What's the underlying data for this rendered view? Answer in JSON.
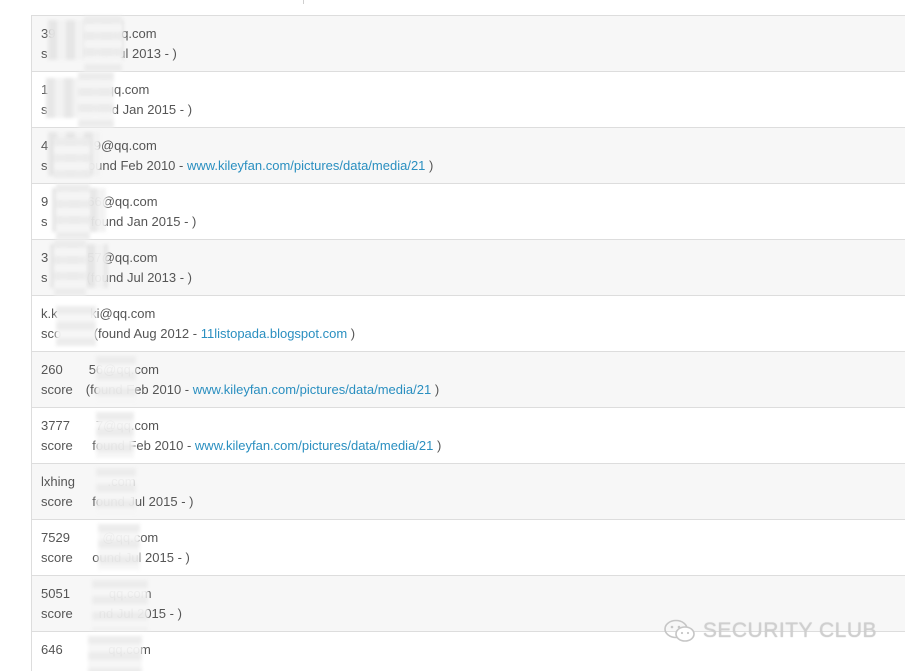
{
  "rows": [
    {
      "email": "39         qq.com",
      "details_prefix": "s      und Jul 2013 - )",
      "link": "",
      "suffix": ""
    },
    {
      "email": "1         qq.com",
      "details_prefix": "s      found Jan 2015 - )",
      "link": "",
      "suffix": ""
    },
    {
      "email": "4       9@qq.com",
      "details_prefix": "s     (found Feb 2010 - ",
      "link": "www.kileyfan.com/pictures/data/media/21",
      "suffix": " )"
    },
    {
      "email": "9      66@qq.com",
      "details_prefix": "s      (found Jan 2015 - )",
      "link": "",
      "suffix": ""
    },
    {
      "email": "3      57@qq.com",
      "details_prefix": "s      (found Jul 2013 - )",
      "link": "",
      "suffix": ""
    },
    {
      "email": "k.k     ki@qq.com",
      "details_prefix": "sco     (found Aug 2012 - ",
      "link": "11listopada.blogspot.com",
      "suffix": " )"
    },
    {
      "email": "260    56@qq.com",
      "details_prefix": "score  (found Feb 2010 - ",
      "link": "www.kileyfan.com/pictures/data/media/21",
      "suffix": " )"
    },
    {
      "email": "3777    7@qq.com",
      "details_prefix": "score   found Feb 2010 - ",
      "link": "www.kileyfan.com/pictures/data/media/21",
      "suffix": " )"
    },
    {
      "email": "lxhing     .com",
      "details_prefix": "score   found Jul 2015 - )",
      "link": "",
      "suffix": ""
    },
    {
      "email": "7529     @qq.com",
      "details_prefix": "score   ound Jul 2015 - )",
      "link": "",
      "suffix": ""
    },
    {
      "email": "5051      qq.com",
      "details_prefix": "score    nd Jul 2015 - )",
      "link": "",
      "suffix": ""
    },
    {
      "email": "646       qq.com",
      "details_prefix": "",
      "link": "",
      "suffix": ""
    }
  ],
  "watermark": {
    "text": "SECURITY CLUB",
    "icon": "wechat-icon"
  },
  "colors": {
    "link": "#2a8fc0",
    "text": "#555555",
    "row_shade": "#f7f7f7",
    "border": "#dddddd"
  }
}
